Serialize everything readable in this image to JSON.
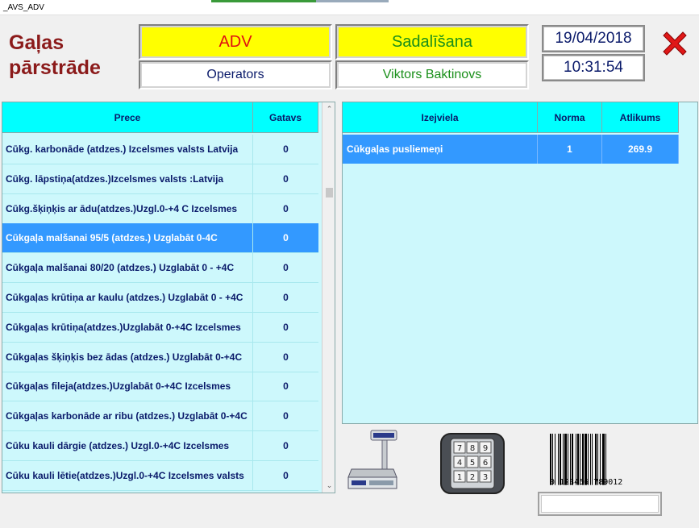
{
  "window": {
    "title": "_AVS_ADV"
  },
  "app": {
    "title_line1": "Gaļas",
    "title_line2": "pārstrāde"
  },
  "header": {
    "dept": "ADV",
    "operation": "Sadalīšana",
    "operator_label": "Operators",
    "operator_name": "Viktors Baktinovs",
    "date": "19/04/2018",
    "time": "10:31:54"
  },
  "colors": {
    "yellow": "#ffff00",
    "cyan_header": "#00ffff",
    "grid_bg": "#cdf8fc",
    "selection": "#3399ff",
    "title_red": "#8b1a1a",
    "close_red": "#e01010"
  },
  "products_table": {
    "columns": [
      "Prece",
      "Gatavs"
    ],
    "selected_index": 3,
    "rows": [
      {
        "name": "Cūkg. karbonāde (atdzes.) Izcelsmes valsts Latvija",
        "ready": "0"
      },
      {
        "name": "Cūkg. lāpstiņa(atdzes.)Izcelsmes valsts :Latvija",
        "ready": "0"
      },
      {
        "name": "Cūkg.šķiņķis ar ādu(atdzes.)Uzgl.0-+4 C Izcelsmes",
        "ready": "0"
      },
      {
        "name": "Cūkgaļa malšanai 95/5 (atdzes.) Uzglabāt 0-4C",
        "ready": "0"
      },
      {
        "name": "Cūkgaļa malšanai 80/20 (atdzes.) Uzglabāt 0 - +4C",
        "ready": "0"
      },
      {
        "name": "Cūkgaļas krūtiņa ar kaulu (atdzes.) Uzglabāt 0 - +4C",
        "ready": "0"
      },
      {
        "name": "Cūkgaļas krūtiņa(atdzes.)Uzglabāt 0-+4C Izcelsmes",
        "ready": "0"
      },
      {
        "name": "Cūkgaļas šķiņķis bez ādas (atdzes.) Uzglabāt 0-+4C",
        "ready": "0"
      },
      {
        "name": "Cūkgaļas fileja(atdzes.)Uzglabāt 0-+4C Izcelsmes",
        "ready": "0"
      },
      {
        "name": "Cūkgaļas karbonāde ar ribu (atdzes.) Uzglabāt 0-+4C",
        "ready": "0"
      },
      {
        "name": "Cūku kauli dārgie (atdzes.) Uzgl.0-+4C Izcelsmes",
        "ready": "0"
      },
      {
        "name": "Cūku kauli lētie(atdzes.)Uzgl.0-+4C Izcelsmes valsts",
        "ready": "0"
      }
    ]
  },
  "materials_table": {
    "columns": [
      "Izejviela",
      "Norma",
      "Atlikums"
    ],
    "rows": [
      {
        "material": "Cūkgaļas pusliemeņi",
        "norm": "1",
        "balance": "269.9"
      }
    ]
  },
  "barcode": {
    "digits": "0  123456  789012",
    "input_value": ""
  },
  "icons": {
    "scale": "scale-icon",
    "keypad": "keypad-icon",
    "close": "close-icon",
    "barcode": "barcode-icon"
  }
}
